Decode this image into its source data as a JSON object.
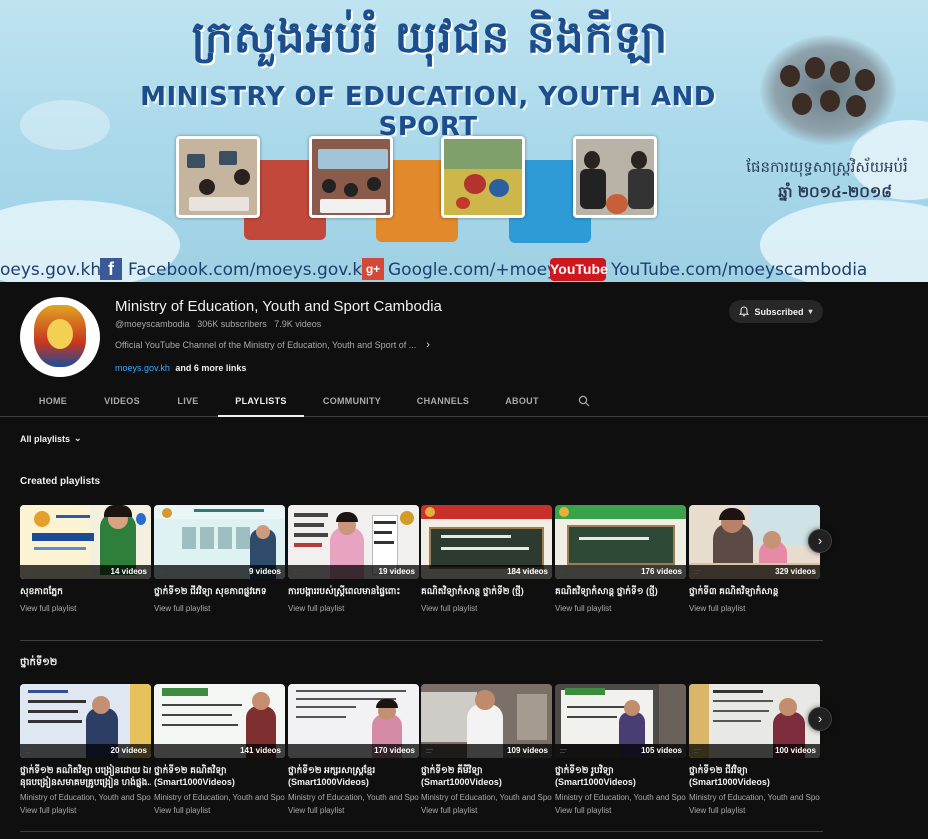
{
  "banner": {
    "khmer_title": "ក្រសួងអប់រំ យុវជន និងកីឡា",
    "english_title": "MINISTRY OF EDUCATION, YOUTH AND SPORT",
    "plan_label": "ផែនការយុទ្ធសាស្រ្តវិស័យអប់រំ",
    "plan_years": "ឆ្នាំ ២០១៤-២០១៨",
    "website": "oeys.gov.kh",
    "facebook": "Facebook.com/moeys.gov.kh",
    "google": "Google.com/+moeys",
    "youtube_logo": "YouTube",
    "youtube": "YouTube.com/moeyscambodia"
  },
  "channel": {
    "name": "Ministry of Education, Youth and Sport Cambodia",
    "handle": "@moeyscambodia",
    "subscribers": "306K subscribers",
    "videos": "7.9K videos",
    "description": "Official YouTube Channel of the Ministry of Education, Youth and Sport of ...",
    "link": "moeys.gov.kh",
    "more_links": "and 6 more links",
    "subscribe_label": "Subscribed"
  },
  "tabs": [
    {
      "label": "HOME"
    },
    {
      "label": "VIDEOS"
    },
    {
      "label": "LIVE"
    },
    {
      "label": "PLAYLISTS"
    },
    {
      "label": "COMMUNITY"
    },
    {
      "label": "CHANNELS"
    },
    {
      "label": "ABOUT"
    }
  ],
  "sort": {
    "label": "All playlists"
  },
  "sections": [
    {
      "title": "Created playlists",
      "playlists": [
        {
          "title": "សុខភាពភ្នែក",
          "count": "14 videos",
          "channel": "",
          "link": "View full playlist"
        },
        {
          "title": "ថ្នាក់ទី១២ ជីវវិទ្យា សុខភាពផ្លូវភេទ",
          "count": "9 videos",
          "channel": "",
          "link": "View full playlist"
        },
        {
          "title": "ការបង្ការរបស់ស្ត្រីពេលមានផ្ទៃពោះ",
          "count": "19 videos",
          "channel": "",
          "link": "View full playlist"
        },
        {
          "title": "គណិតវិទ្យាកំសាន្ត ថ្នាក់ទី២ (ថ្មី)",
          "count": "184 videos",
          "channel": "",
          "link": "View full playlist"
        },
        {
          "title": "គណិតវិទ្យាកំសាន្ត ថ្នាក់ទី១ (ថ្មី)",
          "count": "176 videos",
          "channel": "",
          "link": "View full playlist"
        },
        {
          "title": "ថ្នាក់ទី៣ គណិតវិទ្យាកំសាន្ត",
          "count": "329 videos",
          "channel": "",
          "link": "View full playlist"
        }
      ]
    },
    {
      "title": "ថ្នាក់ទី១២",
      "playlists": [
        {
          "title": "ថ្នាក់ទី១២ គណិតវិទ្យា បង្រៀនដោយ ឯក",
          "subtitle": "នុធបង្រៀនសមាគមគ្រូបង្រៀន ហង់ផ្លុង...",
          "count": "20 videos",
          "channel": "Ministry of Education, Youth and Sport C",
          "link": "View full playlist"
        },
        {
          "title": "ថ្នាក់ទី១២ គណិតវិទ្យា",
          "subtitle": "(Smart1000Videos)",
          "count": "141 videos",
          "channel": "Ministry of Education, Youth and Sport C",
          "link": "View full playlist"
        },
        {
          "title": "ថ្នាក់ទី១២ អក្សរសាស្ត្រខ្មែរ",
          "subtitle": "(Smart1000Videos)",
          "count": "170 videos",
          "channel": "Ministry of Education, Youth and Sport C",
          "link": "View full playlist"
        },
        {
          "title": "ថ្នាក់ទី១២ គីមីវិទ្យា",
          "subtitle": "(Smart1000Videos)",
          "count": "109 videos",
          "channel": "Ministry of Education, Youth and Sport C",
          "link": "View full playlist"
        },
        {
          "title": "ថ្នាក់ទី១២ រូបវិទ្យា",
          "subtitle": "(Smart1000Videos)",
          "count": "105 videos",
          "channel": "Ministry of Education, Youth and Sport C",
          "link": "View full playlist"
        },
        {
          "title": "ថ្នាក់ទី១២ ជីវវិទ្យា",
          "subtitle": "(Smart1000Videos)",
          "count": "100 videos",
          "channel": "Ministry of Education, Youth and Sport C",
          "link": "View full playlist"
        }
      ]
    }
  ],
  "colors": {
    "background": "#0f0f0f",
    "link_blue": "#3ea6ff",
    "banner_blue": "#1c4d8c"
  }
}
